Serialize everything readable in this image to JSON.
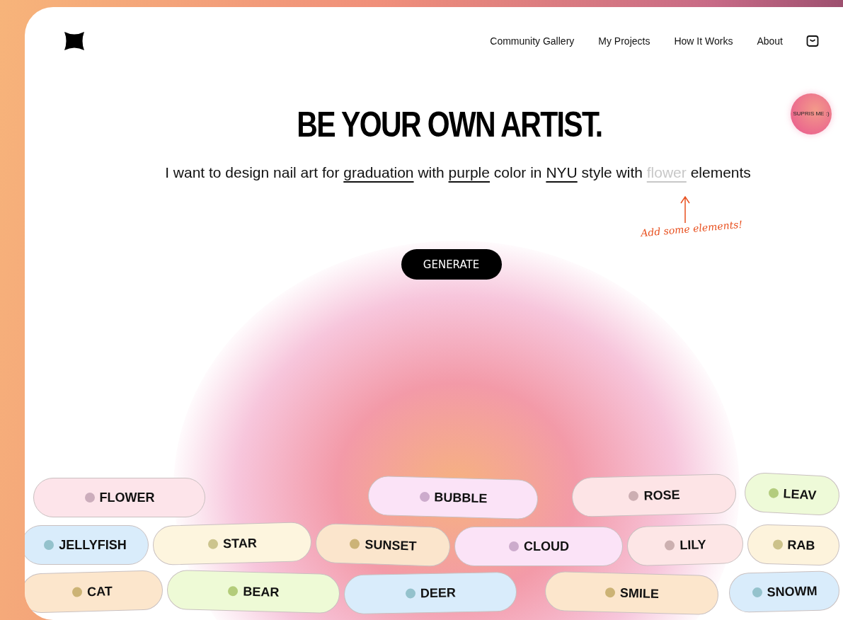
{
  "nav": {
    "links": [
      "Community Gallery",
      "My Projects",
      "How It Works",
      "About"
    ]
  },
  "surprise_button": {
    "label": "SUPRIS ME :)"
  },
  "headline": "BE YOUR OWN ARTIST.",
  "prompt": [
    {
      "kind": "text",
      "text": "I want to design nail art for"
    },
    {
      "kind": "keyword",
      "text": "graduation",
      "filled": true
    },
    {
      "kind": "text",
      "text": "with"
    },
    {
      "kind": "keyword",
      "text": "purple",
      "filled": true
    },
    {
      "kind": "text",
      "text": "color in"
    },
    {
      "kind": "keyword",
      "text": "NYU",
      "filled": true
    },
    {
      "kind": "text",
      "text": "style with"
    },
    {
      "kind": "keyword",
      "text": "flower",
      "filled": false
    },
    {
      "kind": "text",
      "text": "elements"
    }
  ],
  "hint": "Add some elements!",
  "generate_button": "GENERATE",
  "chips": [
    {
      "label": "FLOWER",
      "color": "#fde4ea"
    },
    {
      "label": "BUBBLE",
      "color": "#fbe3f7"
    },
    {
      "label": "ROSE",
      "color": "#fde4e6"
    },
    {
      "label": "LEAV",
      "color": "#eefad8"
    },
    {
      "label": "JELLYFISH",
      "color": "#d9ecfb"
    },
    {
      "label": "STAR",
      "color": "#fdf5de"
    },
    {
      "label": "SUNSET",
      "color": "#fbe5cc"
    },
    {
      "label": "CLOUD",
      "color": "#fbe3f7"
    },
    {
      "label": "LILY",
      "color": "#fde6e6"
    },
    {
      "label": "RAB",
      "color": "#fdf3dc"
    },
    {
      "label": "CAT",
      "color": "#fce6cc"
    },
    {
      "label": "BEAR",
      "color": "#eefad6"
    },
    {
      "label": "DEER",
      "color": "#d9ecfb"
    },
    {
      "label": "SMILE",
      "color": "#fce6cc"
    },
    {
      "label": "SNOWM",
      "color": "#d9ecfb"
    }
  ]
}
